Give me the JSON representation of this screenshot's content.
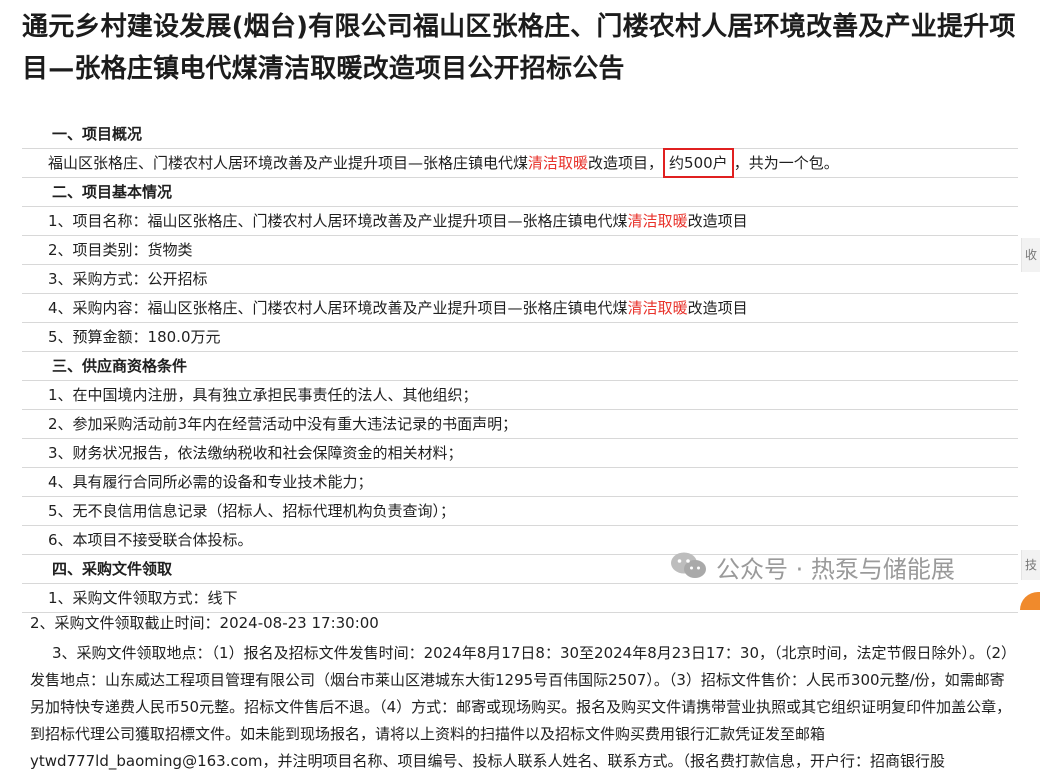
{
  "title": "通元乡村建设发展(烟台)有限公司福山区张格庄、门楼农村人居环境改善及产业提升项目—张格庄镇电代煤清洁取暖改造项目公开招标公告",
  "sections": {
    "overview": {
      "heading": "一、项目概况",
      "text_pre": "福山区张格庄、门楼农村人居环境改善及产业提升项目—张格庄镇电代煤",
      "text_red": "清洁取暖",
      "text_mid": "改造项目，",
      "text_boxed": "约500户",
      "text_post": "，共为一个包。"
    },
    "basic": {
      "heading": "二、项目基本情况",
      "name_pre": "1、项目名称：福山区张格庄、门楼农村人居环境改善及产业提升项目—张格庄镇电代煤",
      "name_red": "清洁取暖",
      "name_post": "改造项目",
      "category": "2、项目类别：货物类",
      "method": "3、采购方式：公开招标",
      "content_pre": "4、采购内容：福山区张格庄、门楼农村人居环境改善及产业提升项目—张格庄镇电代煤",
      "content_red": "清洁取暖",
      "content_post": "改造项目",
      "budget": "5、预算金额：180.0万元"
    },
    "qualification": {
      "heading": "三、供应商资格条件",
      "items": [
        "1、在中国境内注册，具有独立承担民事责任的法人、其他组织；",
        "2、参加采购活动前3年内在经营活动中没有重大违法记录的书面声明；",
        "3、财务状况报告，依法缴纳税收和社会保障资金的相关材料；",
        "4、具有履行合同所必需的设备和专业技术能力；",
        "5、无不良信用信息记录（招标人、招标代理机构负责查询）；",
        "6、本项目不接受联合体投标。"
      ]
    },
    "documents": {
      "heading": "四、采购文件领取",
      "method": "1、采购文件领取方式：线下",
      "deadline": "2、采购文件领取截止时间：2024-08-23 17:30:00",
      "location": "3、采购文件领取地点：（1）报名及招标文件发售时间：2024年8月17日8：30至2024年8月23日17：30，（北京时间，法定节假日除外）。（2）发售地点：山东威达工程项目管理有限公司（烟台市莱山区港城东大街1295号百伟国际2507）。（3）招标文件售价：人民币300元整/份，如需邮寄另加特快专递费人民币50元整。招标文件售后不退。（4）方式：邮寄或现场购买。报名及购买文件请携带营业执照或其它组织证明复印件加盖公章，到招标代理公司獲取招標文件。如未能到现场报名，请将以上资料的扫描件以及招标文件购买费用银行汇款凭证发至邮箱ytwd777ld_baoming@163.com，并注明项目名称、项目编号、投标人联系人姓名、联系方式。（报名费打款信息，开户行：招商银行股"
    }
  },
  "watermark": "公众号 · 热泵与储能展",
  "side_tab": {
    "top": "收",
    "bottom": "技"
  },
  "colors": {
    "highlight": "#e8322b",
    "box": "#e02020"
  }
}
